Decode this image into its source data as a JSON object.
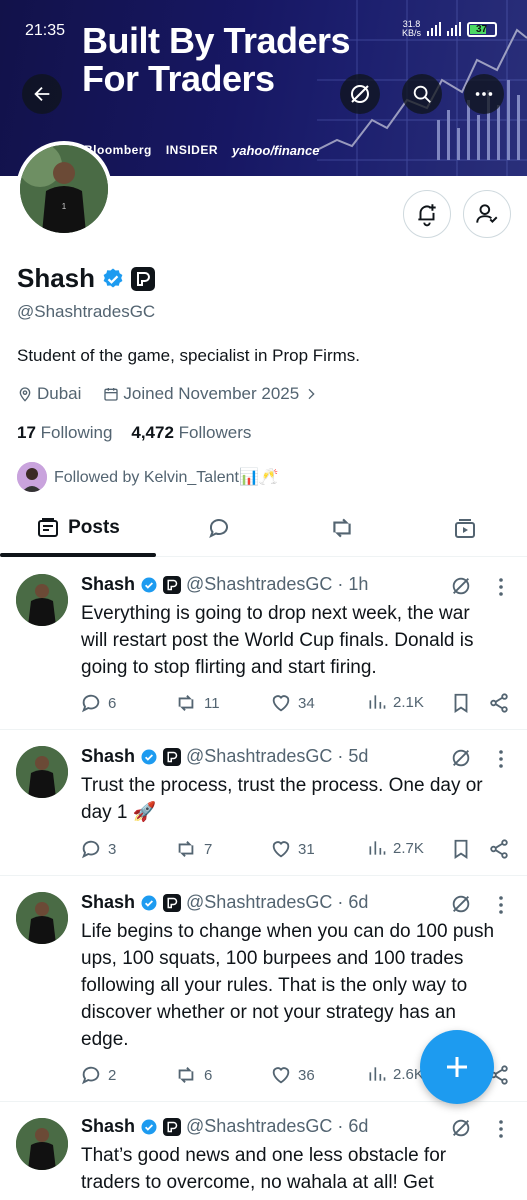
{
  "status_bar": {
    "time": "21:35",
    "network_speed": "31.8",
    "network_unit": "KB/s",
    "battery": "37"
  },
  "banner": {
    "title_line1": "Built By Traders",
    "title_line2": "For Traders",
    "logos": [
      "Bloomberg",
      "INSIDER",
      "yahoo/finance"
    ]
  },
  "profile": {
    "name": "Shash",
    "handle": "@ShashtradesGC",
    "bio": "Student of the game, specialist in Prop Firms.",
    "location": "Dubai",
    "joined": "Joined November 2025",
    "following_count": "17",
    "following_label": "Following",
    "followers_count": "4,472",
    "followers_label": "Followers",
    "followed_by": "Followed by Kelvin_Talent📊🥂"
  },
  "tabs": {
    "posts_label": "Posts"
  },
  "posts": [
    {
      "name": "Shash",
      "handle": "@ShashtradesGC",
      "time": "· 1h",
      "text": "Everything is going to drop next week, the war will restart post the World Cup finals. Donald is going to stop flirting and start firing.",
      "replies": "6",
      "reposts": "11",
      "likes": "34",
      "views": "2.1K"
    },
    {
      "name": "Shash",
      "handle": "@ShashtradesGC",
      "time": "· 5d",
      "text": "Trust the process, trust the process. One day or day 1 🚀",
      "replies": "3",
      "reposts": "7",
      "likes": "31",
      "views": "2.7K"
    },
    {
      "name": "Shash",
      "handle": "@ShashtradesGC",
      "time": "· 6d",
      "text": "Life begins to change when you can do 100 push ups, 100 squats, 100 burpees and 100 trades following all your rules. That is the only way to discover whether or not your strategy has an edge.",
      "replies": "2",
      "reposts": "6",
      "likes": "36",
      "views": "2.6K"
    },
    {
      "name": "Shash",
      "handle": "@ShashtradesGC",
      "time": "· 6d",
      "text": "That’s good news and one less obstacle for traders to overcome, no wahala at all! Get",
      "replies": "",
      "reposts": "",
      "likes": "",
      "views": ""
    }
  ],
  "colors": {
    "accent": "#1d9bf0",
    "text": "#0f1419",
    "muted": "#536471",
    "banner": "#171763"
  },
  "icons": [
    "back-arrow-icon",
    "grok-icon",
    "search-icon",
    "more-icon",
    "bell-plus-icon",
    "following-icon",
    "verified-icon",
    "location-icon",
    "calendar-icon",
    "chevron-right-icon",
    "reply-icon",
    "repost-icon",
    "like-icon",
    "views-icon",
    "bookmark-icon",
    "share-icon",
    "plus-icon"
  ]
}
